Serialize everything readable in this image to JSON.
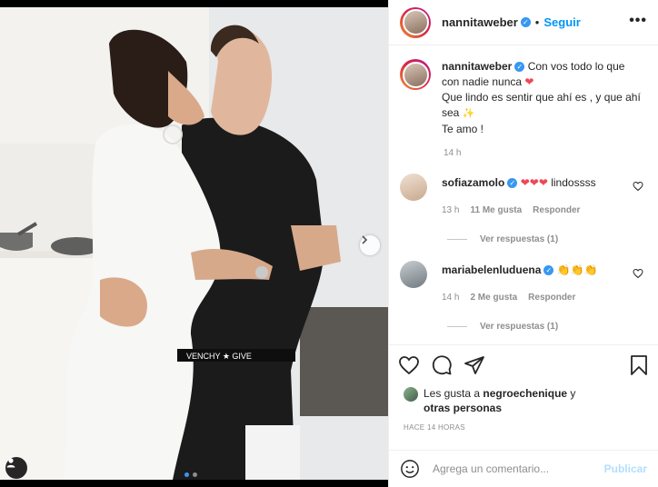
{
  "post": {
    "username": "nannitaweber",
    "separator": "•",
    "follow_label": "Seguir",
    "more_label": "•••"
  },
  "caption": {
    "line1": "Con vos todo lo que con nadie nunca",
    "line2": "Que lindo es sentir que ahí es , y que ahí sea",
    "line3": "Te amo !",
    "time": "14 h"
  },
  "comments": [
    {
      "username": "sofiazamolo",
      "text": "lindossss",
      "emoji": "❤❤❤",
      "time": "13 h",
      "likes": "11 Me gusta",
      "reply": "Responder",
      "view_replies": "Ver respuestas (1)"
    },
    {
      "username": "mariabelenluduena",
      "text": "",
      "emoji": "👏👏👏",
      "time": "14 h",
      "likes": "2 Me gusta",
      "reply": "Responder",
      "view_replies": "Ver respuestas (1)"
    }
  ],
  "likes": {
    "prefix": "Les gusta a",
    "user": "negroechenique",
    "and": "y",
    "others": "otras personas"
  },
  "posted_ago": "HACE 14 HORAS",
  "add_comment": {
    "placeholder": "Agrega un comentario...",
    "publish_label": "Publicar"
  },
  "colors": {
    "accent": "#0095f6",
    "verified": "#3897f0",
    "heart": "#ed4956"
  }
}
